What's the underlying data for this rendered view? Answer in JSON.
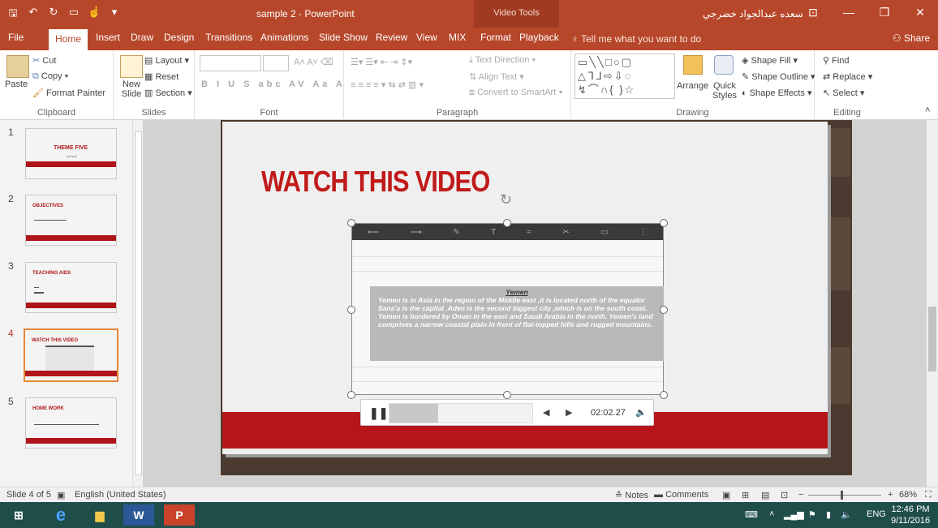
{
  "window": {
    "title": "sample 2 - PowerPoint",
    "context_tab_group": "Video Tools",
    "user_name": "سعده عبدالجواد خضرجي",
    "minimize_glyph": "—",
    "restore_glyph": "❐",
    "close_glyph": "✕"
  },
  "qat": {
    "save_icon": "save-icon",
    "undo_icon": "undo-icon",
    "redo_icon": "redo-icon",
    "present_icon": "present-icon",
    "touch_icon": "touch-mode-icon",
    "customize_icon": "customize-icon"
  },
  "tabs": [
    "File",
    "Home",
    "Insert",
    "Draw",
    "Design",
    "Transitions",
    "Animations",
    "Slide Show",
    "Review",
    "View",
    "MIX",
    "Format",
    "Playback"
  ],
  "active_tab": "Home",
  "tell_me": "Tell me what you want to do",
  "share": "Share",
  "ribbon": {
    "clipboard": {
      "paste": "Paste",
      "cut": "Cut",
      "copy": "Copy",
      "format_painter": "Format Painter",
      "label": "Clipboard"
    },
    "slides": {
      "new_slide": "New Slide",
      "layout": "Layout",
      "reset": "Reset",
      "section": "Section",
      "label": "Slides"
    },
    "font": {
      "label": "Font",
      "buttons": "B I U S abc AV Aa A"
    },
    "paragraph": {
      "text_direction": "Text Direction",
      "align_text": "Align Text",
      "convert_smartart": "Convert to SmartArt",
      "label": "Paragraph"
    },
    "drawing": {
      "arrange": "Arrange",
      "quick_styles": "Quick Styles",
      "shape_fill": "Shape Fill",
      "shape_outline": "Shape Outline",
      "shape_effects": "Shape Effects",
      "label": "Drawing"
    },
    "editing": {
      "find": "Find",
      "replace": "Replace",
      "select": "Select",
      "label": "Editing"
    }
  },
  "slides": [
    {
      "num": "1",
      "title": "THEME FIVE",
      "subtitle": "sample",
      "selected": false
    },
    {
      "num": "2",
      "title": "OBJECTIVES",
      "subtitle": "",
      "selected": false
    },
    {
      "num": "3",
      "title": "TEACHING AIDS",
      "subtitle": "",
      "selected": false
    },
    {
      "num": "4",
      "title": "WATCH THIS VIDEO",
      "subtitle": "",
      "selected": true
    },
    {
      "num": "5",
      "title": "HOME WORK",
      "subtitle": "",
      "selected": false
    }
  ],
  "current_slide": {
    "title": "WATCH THIS VIDEO",
    "video_doc_heading": "Yemen",
    "video_doc_text": "Yemen is in Asia in the region of the Middle east ,it is located north of the equator Sana'a is the capital .Aden is the second biggest city ,which is on the south coast. Yemen is bordered by Oman in the east and Saudi Arabia in the north. Yemen's land comprises a narrow coastal plain in front of flat-topped hills and rugged mountains."
  },
  "player": {
    "time": "02:02.27",
    "progress_fraction": 0.34
  },
  "status": {
    "slide_of": "Slide 4 of 5",
    "language": "English (United States)",
    "notes": "Notes",
    "comments": "Comments",
    "zoom": "68%"
  },
  "taskbar": {
    "lang": "ENG",
    "time": "12:46 PM",
    "date": "9/11/2016"
  },
  "colors": {
    "accent": "#b7472a",
    "slide_red": "#b5151b",
    "taskbar": "#1f4e4a"
  }
}
